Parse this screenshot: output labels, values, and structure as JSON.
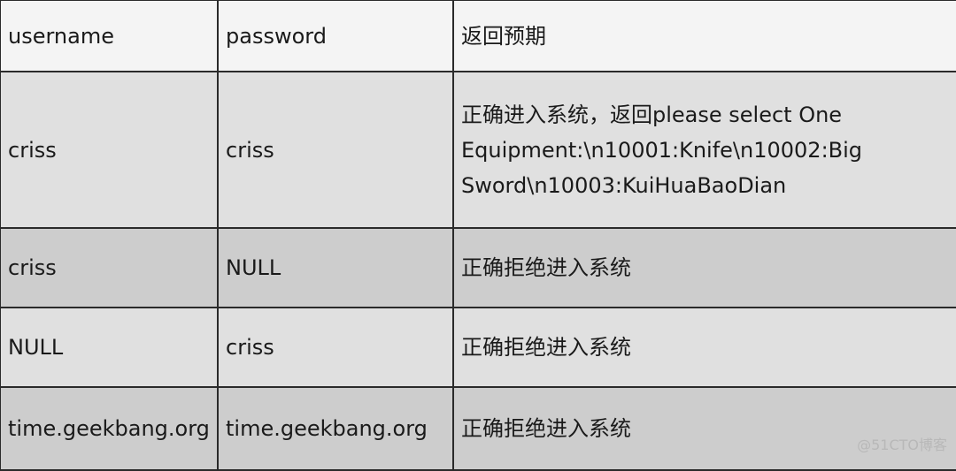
{
  "table": {
    "headers": [
      "username",
      "password",
      "返回预期"
    ],
    "rows": [
      {
        "username": "criss",
        "password": "criss",
        "expected": "正确进入系统，返回please select One Equipment:\\n10001:Knife\\n10002:Big Sword\\n10003:KuiHuaBaoDian"
      },
      {
        "username": "criss",
        "password": "NULL",
        "expected": "正确拒绝进入系统"
      },
      {
        "username": "NULL",
        "password": "criss",
        "expected": "正确拒绝进入系统"
      },
      {
        "username": "time.geekbang.org",
        "password": "time.geekbang.org",
        "expected": "正确拒绝进入系统"
      }
    ]
  },
  "watermark": "@51CTO博客"
}
